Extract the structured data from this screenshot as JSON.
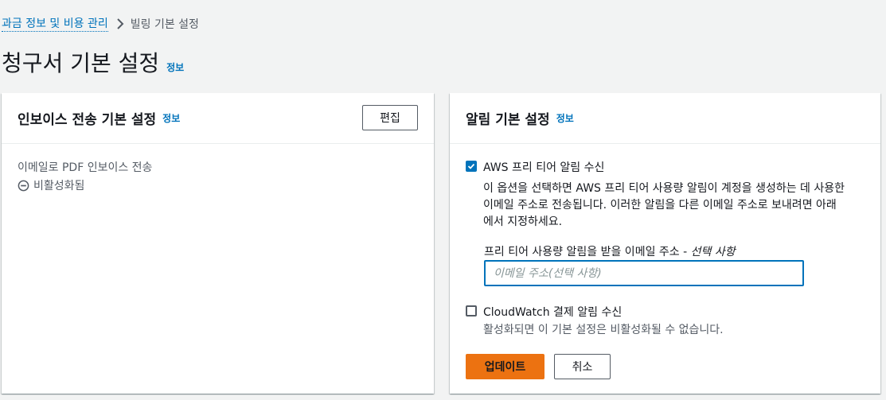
{
  "breadcrumb": {
    "parent": "과금 정보 및 비용 관리",
    "current": "빌링 기본 설정"
  },
  "page": {
    "title": "청구서 기본 설정",
    "info": "정보"
  },
  "invoice_panel": {
    "title": "인보이스 전송 기본 설정",
    "info": "정보",
    "edit_label": "편집",
    "setting_label": "이메일로 PDF 인보이스 전송",
    "status": "비활성화됨"
  },
  "alert_panel": {
    "title": "알림 기본 설정",
    "info": "정보",
    "free_tier": {
      "checked": true,
      "label": "AWS 프리 티어 알림 수신",
      "description_lines": [
        "이 옵션을 선택하면 AWS 프리 티어 사용량 알림이 계정을 생성하는 데 사용한",
        "이메일 주소로 전송됩니다. 이러한 알림을 다른 이메일 주소로 보내려면 아래",
        "에서 지정하세요."
      ],
      "email_label": "프리 티어 사용량 알림을 받을 이메일 주소 - ",
      "email_label_optional": "선택 사항",
      "email_value": "",
      "email_placeholder": "이메일 주소(선택 사항)"
    },
    "cloudwatch": {
      "checked": false,
      "label": "CloudWatch 결제 알림 수신",
      "description": "활성화되면 이 기본 설정은 비활성화될 수 없습니다."
    },
    "update_label": "업데이트",
    "cancel_label": "취소"
  },
  "colors": {
    "background": "#f2f3f3",
    "link": "#0073bb",
    "primary_button": "#ec7211",
    "text": "#16191f",
    "secondary_text": "#545b64"
  },
  "icons": {
    "breadcrumb_separator": "chevron-right-icon",
    "status": "disabled-circle-icon",
    "checkbox": "checkmark-icon"
  }
}
